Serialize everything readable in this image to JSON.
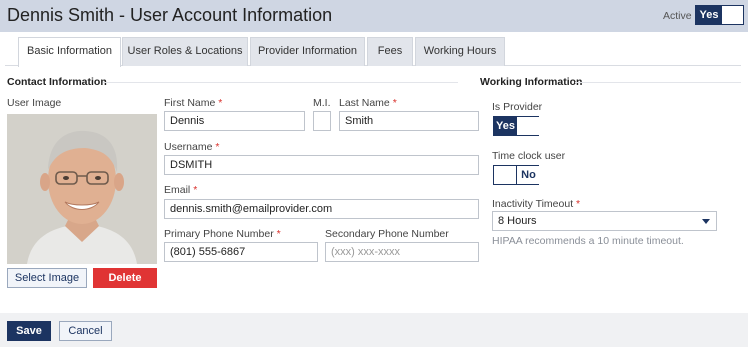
{
  "header": {
    "title": "Dennis Smith - User Account Information",
    "active_label": "Active",
    "active_toggle": "Yes"
  },
  "tabs": [
    {
      "label": "Basic Information",
      "active": true
    },
    {
      "label": "User Roles & Locations",
      "active": false
    },
    {
      "label": "Provider Information",
      "active": false
    },
    {
      "label": "Fees",
      "active": false
    },
    {
      "label": "Working Hours",
      "active": false
    }
  ],
  "contact": {
    "section_title": "Contact Information",
    "user_image_label": "User Image",
    "select_image_label": "Select Image",
    "delete_label": "Delete",
    "first_name": {
      "label": "First Name",
      "required": "*",
      "value": "Dennis"
    },
    "mi": {
      "label": "M.I.",
      "value": ""
    },
    "last_name": {
      "label": "Last Name",
      "required": "*",
      "value": "Smith"
    },
    "username": {
      "label": "Username",
      "required": "*",
      "value": "DSMITH"
    },
    "email": {
      "label": "Email",
      "required": "*",
      "value": "dennis.smith@emailprovider.com"
    },
    "primary_phone": {
      "label": "Primary Phone Number",
      "required": "*",
      "value": "(801) 555-6867"
    },
    "secondary_phone": {
      "label": "Secondary Phone Number",
      "placeholder": "(xxx) xxx-xxxx"
    }
  },
  "working": {
    "section_title": "Working Information",
    "is_provider": {
      "label": "Is Provider",
      "value": "Yes"
    },
    "time_clock": {
      "label": "Time clock user",
      "value": "No"
    },
    "inactivity": {
      "label": "Inactivity Timeout",
      "required": "*",
      "value": "8 Hours",
      "hint": "HIPAA recommends a 10 minute timeout."
    }
  },
  "footer": {
    "save_label": "Save",
    "cancel_label": "Cancel"
  },
  "colors": {
    "navy": "#1c3461",
    "required": "#d9302b",
    "delete": "#e03434",
    "header_bg": "#cfd6e3"
  }
}
